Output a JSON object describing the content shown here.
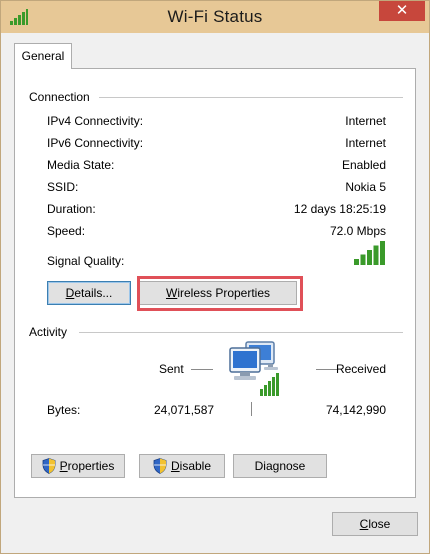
{
  "window": {
    "title": "Wi-Fi Status",
    "close_glyph": "✕"
  },
  "tab": {
    "label": "General"
  },
  "connection": {
    "heading": "Connection",
    "rows": [
      {
        "label": "IPv4 Connectivity:",
        "value": "Internet"
      },
      {
        "label": "IPv6 Connectivity:",
        "value": "Internet"
      },
      {
        "label": "Media State:",
        "value": "Enabled"
      },
      {
        "label": "SSID:",
        "value": "Nokia 5"
      },
      {
        "label": "Duration:",
        "value": "12 days 18:25:19"
      },
      {
        "label": "Speed:",
        "value": "72.0 Mbps"
      }
    ],
    "signal_label": "Signal Quality:",
    "signal_bars": 5,
    "details_button": {
      "mnemonic": "D",
      "rest": "etails..."
    },
    "wireless_button": {
      "mnemonic": "W",
      "rest": "ireless Properties"
    }
  },
  "activity": {
    "heading": "Activity",
    "sent_label": "Sent",
    "received_label": "Received",
    "bytes_label": "Bytes:",
    "bytes_sent": "24,071,587",
    "bytes_received": "74,142,990"
  },
  "buttons": {
    "properties": {
      "mnemonic": "P",
      "rest": "roperties"
    },
    "disable": {
      "mnemonic": "D",
      "rest": "isable"
    },
    "diagnose": {
      "label": "Diagnose"
    },
    "close": {
      "mnemonic": "C",
      "rest": "lose"
    }
  },
  "icons": {
    "title": "wifi-signal-icon",
    "signal": "signal-bars-icon",
    "activity": "network-computers-icon",
    "shield": "uac-shield-icon"
  },
  "colors": {
    "titlebar": "#e7c896",
    "close_button": "#c7473c",
    "signal_green": "#3a9a2a",
    "highlight": "#e05058"
  }
}
